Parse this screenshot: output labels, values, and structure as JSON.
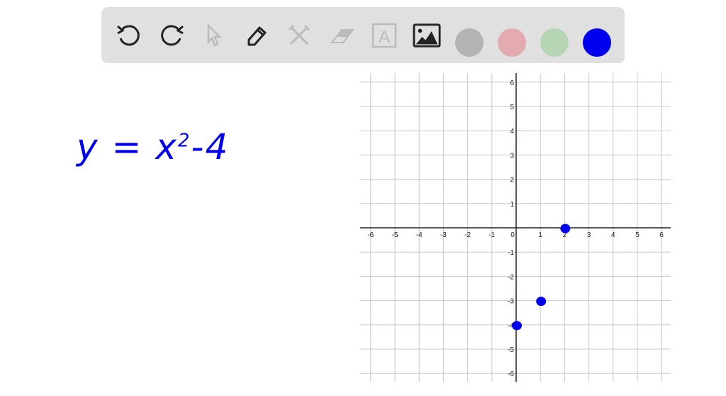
{
  "toolbar": {
    "tools": [
      {
        "name": "undo-icon",
        "enabled": true
      },
      {
        "name": "redo-icon",
        "enabled": true
      },
      {
        "name": "select-pointer-icon",
        "enabled": false
      },
      {
        "name": "pen-icon",
        "enabled": true,
        "selected": true
      },
      {
        "name": "tools-icon",
        "enabled": false
      },
      {
        "name": "eraser-icon",
        "enabled": false
      },
      {
        "name": "text-icon",
        "enabled": false
      },
      {
        "name": "image-icon",
        "enabled": true
      }
    ],
    "text_tool_glyph": "A",
    "colors": [
      "#b3b3b3",
      "#e3aab0",
      "#b5d5b5",
      "#0000ee"
    ],
    "active_color": "#0000ee"
  },
  "canvas": {
    "equation": {
      "base": "y = x",
      "exponent": "2",
      "tail": "-4"
    },
    "ink_color": "#0000ee"
  },
  "chart_data": {
    "type": "scatter",
    "xlim": [
      -6,
      6
    ],
    "ylim": [
      -6,
      6
    ],
    "x_ticks": [
      "-6",
      "-5",
      "-4",
      "-3",
      "-2",
      "-1",
      "0",
      "1",
      "2",
      "3",
      "4",
      "5",
      "6"
    ],
    "y_ticks": [
      "6",
      "5",
      "4",
      "3",
      "2",
      "1",
      "-1",
      "-2",
      "-3",
      "-4",
      "-5",
      "-6"
    ],
    "grid": true,
    "points": [
      {
        "x": 2,
        "y": 0
      },
      {
        "x": 1,
        "y": -3
      },
      {
        "x": 0,
        "y": -4
      }
    ],
    "point_color": "#0000ee"
  }
}
